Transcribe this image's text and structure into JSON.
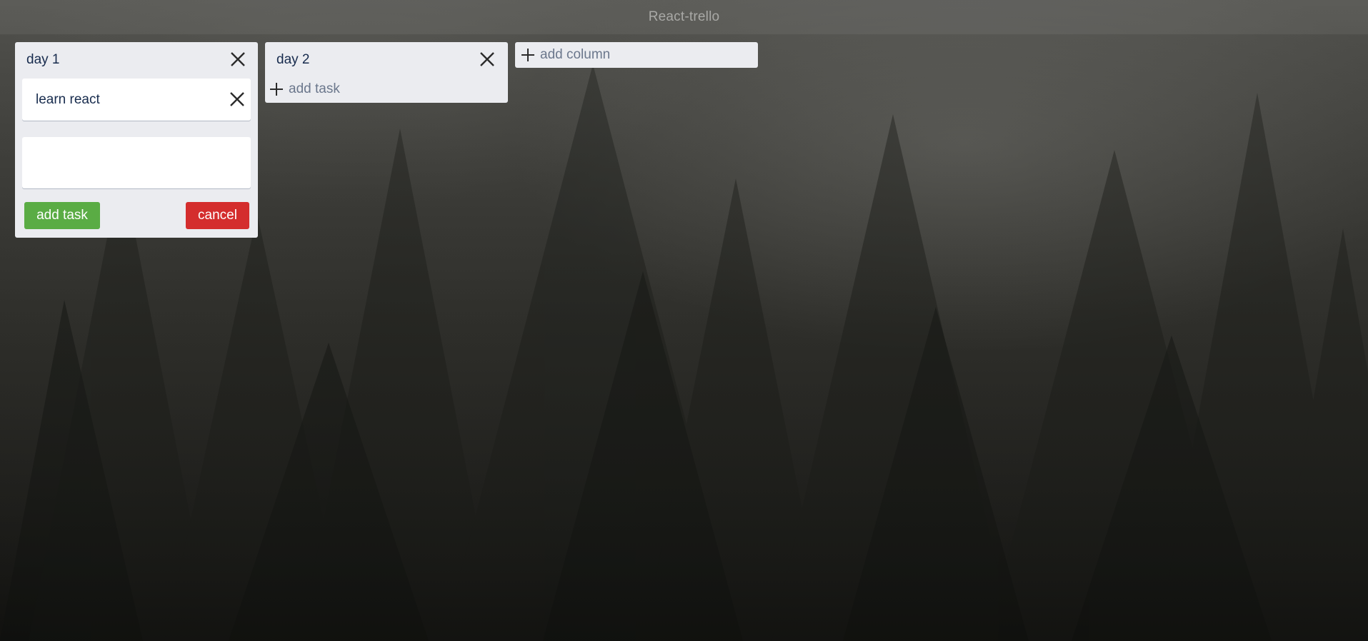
{
  "app": {
    "title": "React-trello"
  },
  "columns": [
    {
      "title": "day 1",
      "cards": [
        {
          "text": "learn react"
        }
      ],
      "composer": {
        "value": "",
        "add_label": "add task",
        "cancel_label": "cancel"
      }
    },
    {
      "title": "day 2",
      "cards": [],
      "add_task_label": "add task"
    }
  ],
  "add_column": {
    "label": "add column"
  },
  "icons": {
    "close": "close-icon",
    "plus": "plus-icon"
  },
  "colors": {
    "column_bg": "#ebecf0",
    "add_button": "#5aac44",
    "cancel_button": "#d42d2d",
    "title_text": "#a9a9a6"
  }
}
